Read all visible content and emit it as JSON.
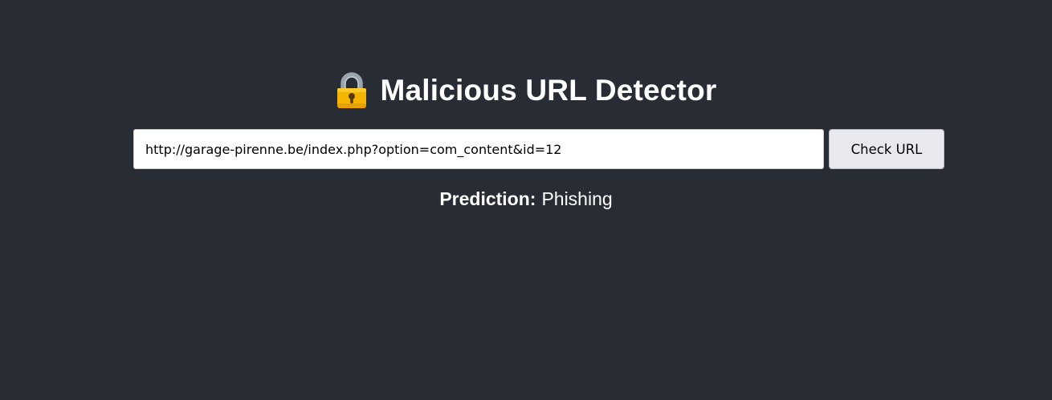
{
  "header": {
    "icon": "lock-icon",
    "title": "Malicious URL Detector"
  },
  "form": {
    "url_value": "http://garage-pirenne.be/index.php?option=com_content&id=12",
    "button_label": "Check URL"
  },
  "result": {
    "label": "Prediction:",
    "value": "Phishing"
  },
  "colors": {
    "background": "#282c34",
    "text": "#ffffff",
    "button_bg": "#e9e8ee",
    "lock_body": "#f4b400",
    "lock_shackle": "#9aa4ad"
  }
}
